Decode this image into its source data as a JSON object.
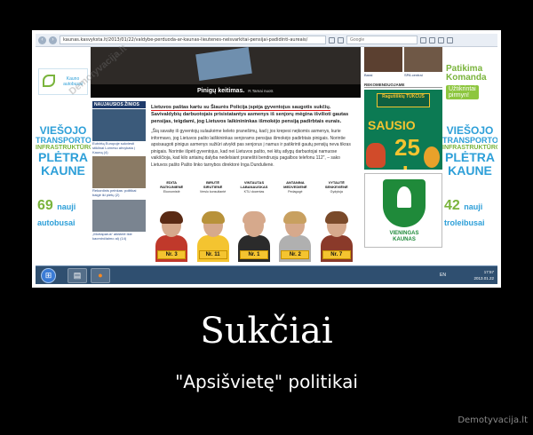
{
  "poster": {
    "title": "Sukčiai",
    "subtitle": "\"Apsišvietę\" politikai",
    "site": "Demotyvacija.lt",
    "watermark": "Demotyvacija.lt"
  },
  "browser": {
    "url": "kaunas.kasvyksta.lt/2013/01/22/valdybe-perduoda-ar-kaunas-lieutenes-neisvarkitai-pensijai-padidinti-aureais/",
    "search_placeholder": "Google"
  },
  "left_ad": {
    "logo_text": "Kauno autobusai",
    "line1": "VIEŠOJO",
    "line2": "TRANSPORTO",
    "line3": "INFRASTRUKTŪROS",
    "line4": "PLĖTRA",
    "line5": "KAUNE",
    "count": "69",
    "count_label_1": "nauji",
    "count_label_2": "autobusai"
  },
  "right_ad": {
    "brand_1": "Patikima",
    "brand_2": "Komanda",
    "tag_1": "Užtikrintai",
    "tag_2": "pirmyn!",
    "line1": "VIEŠOJO",
    "line2": "TRANSPORTO",
    "line3": "INFRASTRUKTŪROS",
    "line4": "PLĖTRA",
    "line5": "KAUNE",
    "count": "42",
    "count_label_1": "nauji",
    "count_label_2": "troleibusai"
  },
  "hero": {
    "caption": "Pinigų keitimas.",
    "caption_small": "R.Tamai nuotr."
  },
  "news": {
    "header": "NAUJAUSIOS ŽINIOS",
    "items": [
      {
        "text": "Eutvirtą Europoje sukviesti stiklinai Lorneso ahvykata į Kauną (4)"
      },
      {
        "text": "Rekordinis pelnkas: politikai baigė iki pietų (2)"
      },
      {
        "text": "„Mortaparus“ aikštelė ikie kaominčiaimo ai) (14)"
      }
    ]
  },
  "article": {
    "lead_highlight": "Lietuvos paštas kartu su Šiaurės Policija įspėja gyventojus saugotis sukčių.",
    "lead_rest": "Savivaldybių darbuotojais prisistatantys asmenys iš senjorų mėgina išvilioti gautas pensijas, teigdami, jog Lietuvos laikinininkas išmokėjo pensiją padirbtais eurais.",
    "body": "„Šią savaitę iš gyventojų sulaukėme keleto pranešimų, kad į jos krepesi neįkomis asmenys, kurie informavo, jog Lietuvos pašto laiškininkas senjorams pensijas išmokėjo padirbtais pinigais. Norintie apsisaugoti pinigus asmenys sužiūri atvykti pas senjorus į namus ir patikrinti gautų pensijų neva tikras pinigais. Norintie išpėti gyventojus, kad nei Lietuvos pašto, nei kitų atlygų darbuotojai namuose vaikščioja, kad kilo antainų dalyba nedelsiant praneštii bendruoju pagalbos telefonu 112\", – sako Lietuvos pašto Pašto linko tarnybos direktorė Inga Dundulienė."
  },
  "candidates": [
    {
      "name": "EDITA",
      "surname": "RATKUNIENĖ",
      "role": "Ekonomistė",
      "nr": "Nr. 3",
      "hair": "#5a2a14",
      "shirt": "#c0392b"
    },
    {
      "name": "BIRUTĖ",
      "surname": "SIRUTIENĖ",
      "role": "Verslo konsultantė",
      "nr": "Nr. 11",
      "hair": "#b8923a",
      "shirt": "#f4c430"
    },
    {
      "name": "VINTAUTAS",
      "surname": "LABANAUSKAS",
      "role": "KTU docentas",
      "nr": "Nr. 1",
      "hair": "#d6a98c",
      "shirt": "#2b2b2b"
    },
    {
      "name": "ANTANINA",
      "surname": "MEDVEDIENĖ",
      "role": "Pedagogė",
      "nr": "Nr. 2",
      "hair": "#c8a060",
      "shirt": "#b0b0b0"
    },
    {
      "name": "VYTAUTĖ",
      "surname": "SENKEVIĖNĖ",
      "role": "Gydytoja",
      "nr": "Nr. 7",
      "hair": "#7a4a2a",
      "shirt": "#8a3a2a"
    }
  ],
  "right_column": {
    "top_left_caption": "Barai",
    "top_right_caption": "SPA centrai",
    "rekom_header": "REKOMENDUOJAME",
    "tukas_top": "Ragutiškių TUKCUS",
    "tukas_month": "SAUSIO",
    "tukas_day": "25 d.",
    "vien_1": "VIENINGAS",
    "vien_2": "KAUNAS"
  },
  "taskbar": {
    "lang": "EN",
    "time": "17:57",
    "date": "2013.01.22"
  }
}
